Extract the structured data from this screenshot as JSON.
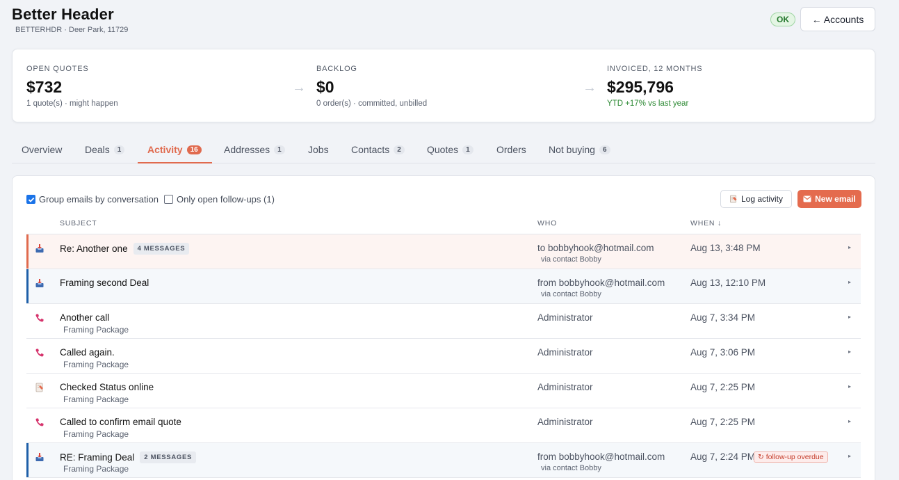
{
  "account": {
    "name": "Better Header",
    "subtitle": "BETTERHDR · Deer Park, 11729",
    "status": "OK",
    "back_label": "← Accounts"
  },
  "summary": [
    {
      "label": "OPEN QUOTES",
      "value": "$732",
      "note": "1 quote(s) · might happen"
    },
    {
      "label": "BACKLOG",
      "value": "$0",
      "note": "0 order(s) · committed, unbilled"
    },
    {
      "label": "INVOICED, 12 MONTHS",
      "value": "$295,796",
      "note": "YTD +17% vs last year"
    }
  ],
  "tabs": [
    {
      "label": "Overview",
      "count": ""
    },
    {
      "label": "Deals",
      "count": "1"
    },
    {
      "label": "Activity",
      "count": "16"
    },
    {
      "label": "Addresses",
      "count": "1"
    },
    {
      "label": "Jobs",
      "count": ""
    },
    {
      "label": "Contacts",
      "count": "2"
    },
    {
      "label": "Quotes",
      "count": "1"
    },
    {
      "label": "Orders",
      "count": ""
    },
    {
      "label": "Not buying",
      "count": "6"
    }
  ],
  "activity": {
    "filter_group_label": "Group emails by conversation",
    "filter_open_label": "Only open follow-ups (1)",
    "log_button": "Log activity",
    "new_button": "New email",
    "columns": {
      "subject": "SUBJECT",
      "who": "WHO",
      "when": "WHEN ↓"
    },
    "rows": [
      {
        "icon": "inbox-icon",
        "subject": "Re: Another one",
        "messages": "4 MESSAGES",
        "context": "",
        "who": "to bobbyhook@hotmail.com",
        "via": "via contact Bobby",
        "when": "Aug 13, 3:48 PM",
        "overdue": ""
      },
      {
        "icon": "inbox-icon",
        "subject": "Framing second Deal",
        "messages": "",
        "context": "",
        "who": "from bobbyhook@hotmail.com",
        "via": "via contact Bobby",
        "when": "Aug 13, 12:10 PM",
        "overdue": ""
      },
      {
        "icon": "phone-icon",
        "subject": "Another call",
        "messages": "",
        "context": "Framing Package",
        "who": "Administrator",
        "via": "",
        "when": "Aug 7, 3:34 PM",
        "overdue": ""
      },
      {
        "icon": "phone-icon",
        "subject": "Called again.",
        "messages": "",
        "context": "Framing Package",
        "who": "Administrator",
        "via": "",
        "when": "Aug 7, 3:06 PM",
        "overdue": ""
      },
      {
        "icon": "note-icon",
        "subject": "Checked Status online",
        "messages": "",
        "context": "Framing Package",
        "who": "Administrator",
        "via": "",
        "when": "Aug 7, 2:25 PM",
        "overdue": ""
      },
      {
        "icon": "phone-icon",
        "subject": "Called to confirm email quote",
        "messages": "",
        "context": "Framing Package",
        "who": "Administrator",
        "via": "",
        "when": "Aug 7, 2:25 PM",
        "overdue": ""
      },
      {
        "icon": "inbox-icon",
        "subject": "RE: Framing Deal",
        "messages": "2 MESSAGES",
        "context": "Framing Package",
        "who": "from bobbyhook@hotmail.com",
        "via": "via contact Bobby",
        "when": "Aug 7, 2:24 PM",
        "overdue": "↻ follow-up overdue"
      }
    ]
  },
  "colors": {
    "accent": "#e06a4e",
    "highlight_orange": "#fdf4f2",
    "highlight_blue": "#f5f8fb",
    "bar_orange": "#e06a4e",
    "bar_blue": "#1e5fa8",
    "ok_green": "#23772c"
  }
}
